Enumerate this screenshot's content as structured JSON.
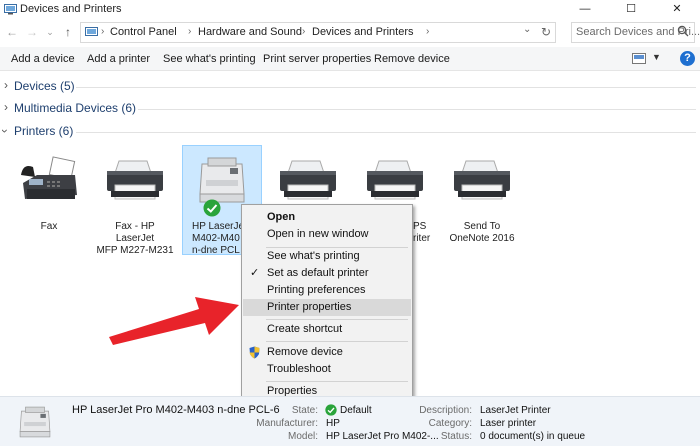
{
  "window": {
    "title": "Devices and Printers",
    "minimize": "—",
    "maximize": "☐",
    "close": "✕"
  },
  "address": {
    "crumbs": [
      "Control Panel",
      "Hardware and Sound",
      "Devices and Printers"
    ],
    "search_placeholder": "Search Devices and Pri..."
  },
  "commands": {
    "add_device": "Add a device",
    "add_printer": "Add a printer",
    "see_printing": "See what's printing",
    "server_props": "Print server properties",
    "remove_device": "Remove device",
    "help": "?"
  },
  "groups": {
    "devices": "Devices (5)",
    "multimedia": "Multimedia Devices (6)",
    "printers": "Printers (6)"
  },
  "printers": [
    {
      "name": "Fax",
      "icon": "fax-icon"
    },
    {
      "name": "Fax - HP LaserJet MFP M227-M231",
      "icon": "printer-icon"
    },
    {
      "name": "HP LaserJet Pro M402-M403 n-dne PCL 6",
      "icon": "laser-printer-icon",
      "visible_label": [
        "HP LaserJet",
        "M402-M40",
        "n-dne PCL"
      ],
      "default": true
    },
    {
      "name": "",
      "icon": "printer-icon"
    },
    {
      "name": "",
      "icon": "printer-icon",
      "visible_label": [
        "PS",
        "riter"
      ]
    },
    {
      "name": "Send To OneNote 2016",
      "icon": "printer-icon",
      "visible_label": [
        "Send To",
        "OneNote 2016"
      ]
    }
  ],
  "context_menu": {
    "open": "Open",
    "open_new_window": "Open in new window",
    "see_printing": "See what's printing",
    "set_default": "Set as default printer",
    "printing_prefs": "Printing preferences",
    "printer_props": "Printer properties",
    "create_shortcut": "Create shortcut",
    "remove_device": "Remove device",
    "troubleshoot": "Troubleshoot",
    "properties": "Properties"
  },
  "details": {
    "device_name": "HP LaserJet Pro M402-M403 n-dne PCL-6",
    "state_label": "State:",
    "state_value": "Default",
    "manufacturer_label": "Manufacturer:",
    "manufacturer_value": "HP",
    "model_label": "Model:",
    "model_value": "HP LaserJet Pro M402-...",
    "description_label": "Description:",
    "description_value": "LaserJet Printer",
    "category_label": "Category:",
    "category_value": "Laser printer",
    "status_label": "Status:",
    "status_value": "0 document(s) in queue"
  },
  "colors": {
    "selection": "#cce8ff",
    "accent_arrow": "#e8232a",
    "default_check": "#2aa43b",
    "help_blue": "#1e6fd0"
  }
}
